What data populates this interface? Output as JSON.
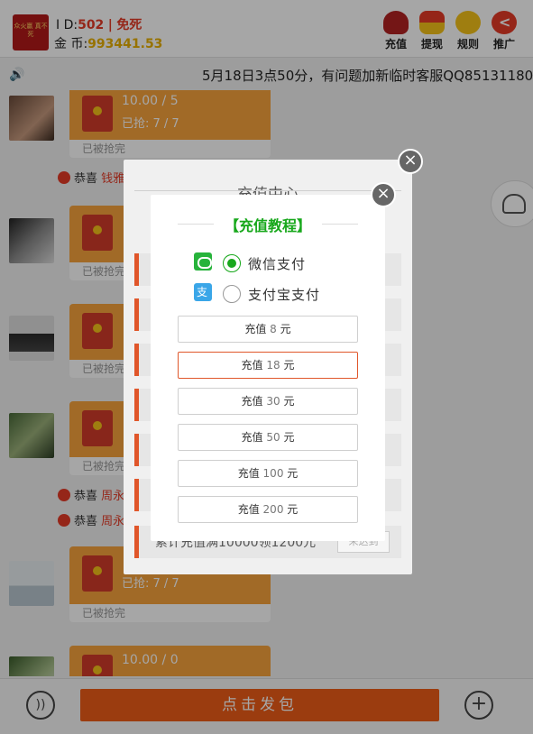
{
  "header": {
    "logo_text": "众火赢 真不死",
    "id_label": "I D:",
    "id_value": "502",
    "separator": "|",
    "mode_label": "免死",
    "coins_label": "金 币:",
    "coins_value": "993441.53",
    "buttons": [
      {
        "label": "充值",
        "icon": "recharge-bag-icon"
      },
      {
        "label": "提现",
        "icon": "withdraw-gift-icon"
      },
      {
        "label": "规则",
        "icon": "rules-mascot-icon"
      },
      {
        "label": "推广",
        "icon": "share-icon"
      }
    ]
  },
  "marquee": {
    "icon": "speaker-icon",
    "text": "5月18日3点50分，有问题加新临时客服QQ85131180"
  },
  "feed": {
    "packets": [
      {
        "amount": "10.00 / 5",
        "taken": "已抢: 7 / 7",
        "status": "已被抢完"
      },
      {
        "amount": "",
        "taken": "",
        "status": "已被抢完"
      },
      {
        "amount": "",
        "taken": "",
        "status": "已被抢完"
      },
      {
        "amount": "",
        "taken": "",
        "status": "已被抢完"
      },
      {
        "amount": "",
        "taken": "已抢: 7 / 7",
        "status": "已被抢完"
      },
      {
        "amount": "10.00 / 0",
        "taken": "",
        "status": ""
      }
    ],
    "congrats": [
      {
        "prefix": "恭喜",
        "name": "钱雅"
      },
      {
        "prefix": "恭喜",
        "name": "周永"
      },
      {
        "prefix": "恭喜",
        "name": "周永"
      }
    ]
  },
  "contact_icon": "contacts-icon",
  "back_modal": {
    "title": "充值中心",
    "bottom_row_text": "累计充值满10000领1200元",
    "bottom_row_badge": "未达到"
  },
  "front_modal": {
    "title": "【充值教程】",
    "payment_methods": [
      {
        "label": "微信支付",
        "icon": "wechat-pay-icon",
        "selected": true
      },
      {
        "label": "支付宝支付",
        "icon": "alipay-icon",
        "selected": false
      }
    ],
    "amounts": [
      {
        "prefix": "充值",
        "value": "8",
        "unit": "元"
      },
      {
        "prefix": "充值",
        "value": "18",
        "unit": "元"
      },
      {
        "prefix": "充值",
        "value": "30",
        "unit": "元"
      },
      {
        "prefix": "充值",
        "value": "50",
        "unit": "元"
      },
      {
        "prefix": "充值",
        "value": "100",
        "unit": "元"
      },
      {
        "prefix": "充值",
        "value": "200",
        "unit": "元"
      }
    ]
  },
  "bottom_bar": {
    "send_label": "点击发包",
    "voice_icon": "voice-icon",
    "plus_icon": "plus-icon"
  },
  "colors": {
    "accent_orange": "#ef5d18",
    "packet_orange": "#f7a33d",
    "brand_red": "#e53b27",
    "coin_gold": "#e8b000",
    "tutorial_green": "#18a81c"
  }
}
